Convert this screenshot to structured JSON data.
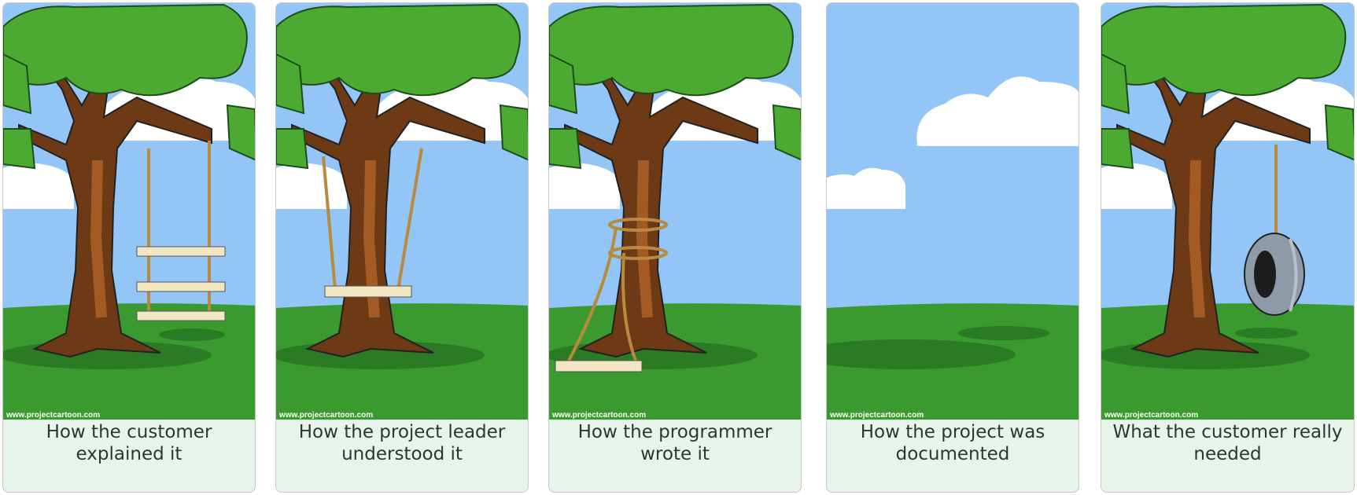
{
  "panels": [
    {
      "id": "customer-explained",
      "caption": "How the customer explained it",
      "credit": "www.projectcartoon.com"
    },
    {
      "id": "leader-understood",
      "caption": "How the project leader understood it",
      "credit": "www.projectcartoon.com"
    },
    {
      "id": "programmer-wrote",
      "caption": "How the programmer wrote it",
      "credit": "www.projectcartoon.com"
    },
    {
      "id": "project-documented",
      "caption": "How the project was documented",
      "credit": "www.projectcartoon.com"
    },
    {
      "id": "customer-needed",
      "caption": "What the customer really needed",
      "credit": "www.projectcartoon.com"
    }
  ],
  "colors": {
    "sky": "#93c5f6",
    "grass": "#3a9a30",
    "shadow": "#2b7a24",
    "trunk": "#6e3a16",
    "trunk_light": "#a35a24",
    "foliage": "#4caa32",
    "foliage_dark": "#2c7c24",
    "cloud": "#ffffff",
    "rope": "#b88a3e",
    "plank": "#f3e6c2",
    "tire": "#8e9aa8",
    "caption_bg": "#e7f4ea"
  }
}
